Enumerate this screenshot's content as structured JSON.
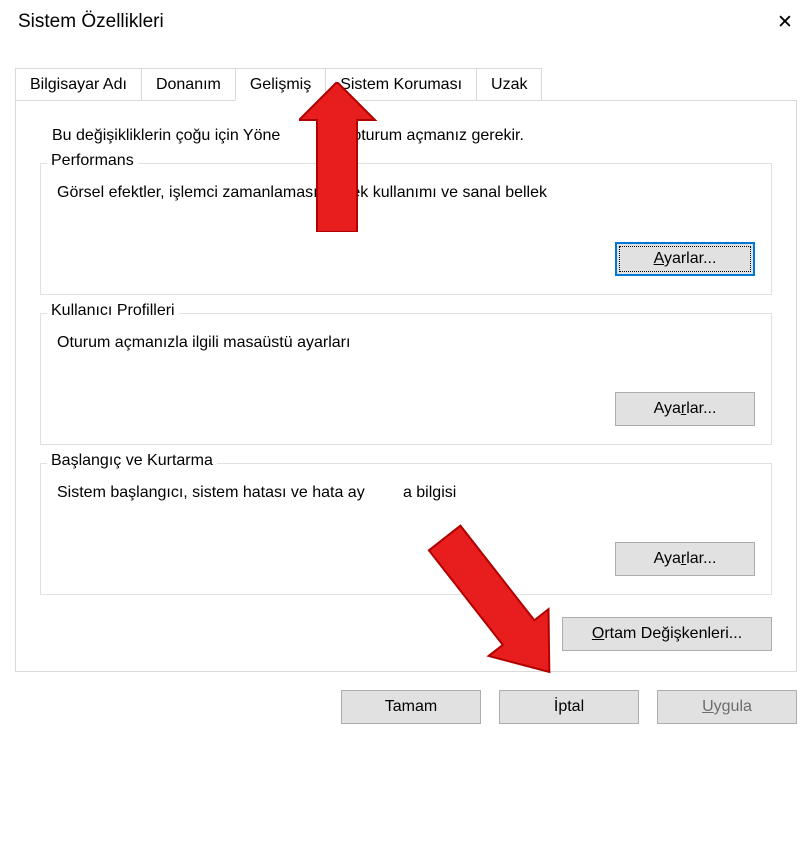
{
  "window": {
    "title": "Sistem Özellikleri"
  },
  "tabs": {
    "computer_name": "Bilgisayar Adı",
    "hardware": "Donanım",
    "advanced": "Gelişmiş",
    "system_protection": "Sistem Koruması",
    "remote": "Uzak"
  },
  "panel": {
    "intro_full": "Bu değişikliklerin çoğu için Yönetici olarak oturum açmanız gerekir.",
    "intro_visible_left": "Bu değişikliklerin çoğu için Yöne",
    "intro_visible_right": "rak oturum açmanız gerekir.",
    "performance": {
      "legend": "Performans",
      "desc_full": "Görsel efektler, işlemci zamanlaması, bellek kullanımı ve sanal bellek",
      "desc_left": "Görsel efektler, işlemci zamanlaması,",
      "desc_right": "llek kullanımı ve sanal bellek",
      "button": "Ayarlar..."
    },
    "profiles": {
      "legend": "Kullanıcı Profilleri",
      "desc": "Oturum açmanızla ilgili masaüstü ayarları",
      "button": "Ayarlar..."
    },
    "startup": {
      "legend": "Başlangıç ve Kurtarma",
      "desc_full": "Sistem başlangıcı, sistem hatası ve hata ayıklama bilgisi",
      "desc_left": "Sistem başlangıcı, sistem hatası ve hata ay",
      "desc_right": "a bilgisi",
      "button": "Ayarlar..."
    },
    "env_button": "Ortam Değişkenleri..."
  },
  "dialog": {
    "ok": "Tamam",
    "cancel": "İptal",
    "apply": "Uygula"
  },
  "annotations": {
    "arrow1": "red-arrow-pointing-to-advanced-tab",
    "arrow2": "red-arrow-pointing-to-environment-variables"
  }
}
